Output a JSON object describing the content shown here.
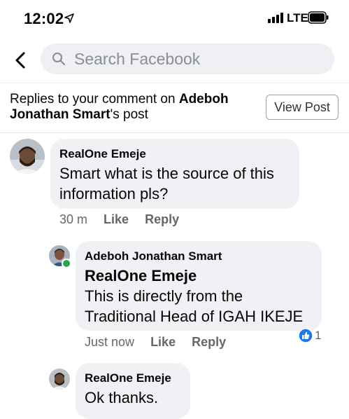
{
  "status_bar": {
    "time": "12:02",
    "network": "LTE"
  },
  "search": {
    "placeholder": "Search Facebook"
  },
  "header": {
    "title_prefix": "Replies to your comment on ",
    "title_name": "Adeboh Jonathan Smart",
    "title_suffix": "'s post",
    "view_post_label": "View Post"
  },
  "comments": [
    {
      "author": "RealOne Emeje",
      "lines": [
        "Smart what is the source of this",
        "information pls?"
      ],
      "time": "30 m",
      "like_label": "Like",
      "reply_label": "Reply"
    },
    {
      "author": "Adeboh Jonathan Smart",
      "mention": "RealOne Emeje",
      "lines": [
        "This is directly from the",
        "Traditional Head of IGAH IKEJE"
      ],
      "time": "Just now",
      "like_label": "Like",
      "reply_label": "Reply",
      "reaction_count": "1"
    },
    {
      "author": "RealOne Emeje",
      "lines": [
        "Ok thanks."
      ]
    }
  ],
  "colors": {
    "accent": "#1877f2",
    "bubble": "#eff1f4",
    "meta": "#65676b",
    "online": "#31a24c"
  }
}
